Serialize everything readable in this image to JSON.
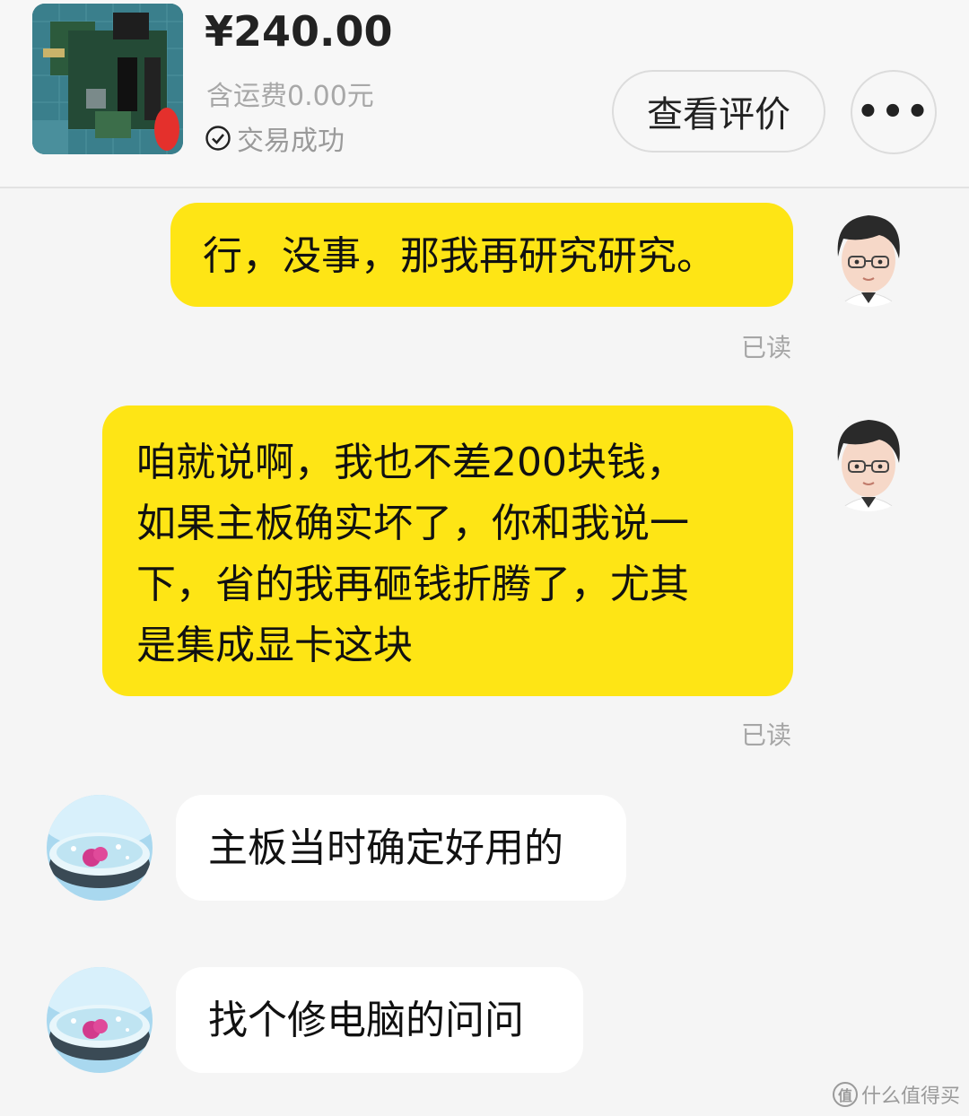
{
  "order": {
    "price": "¥240.00",
    "shipping": "含运费0.00元",
    "status": "交易成功",
    "review_button": "查看评价",
    "more_button": "•••"
  },
  "messages": [
    {
      "sender": "me",
      "text": "行，没事，那我再研究研究。",
      "read": "已读"
    },
    {
      "sender": "me",
      "lines": [
        "咱就说啊，我也不差200块钱，",
        "如果主板确实坏了，你和我说一",
        "下，省的我再砸钱折腾了，尤其",
        "是集成显卡这块"
      ],
      "read": "已读"
    },
    {
      "sender": "them",
      "text": "主板当时确定好用的"
    },
    {
      "sender": "them",
      "text": "找个修电脑的问问"
    }
  ],
  "watermark": {
    "icon_text": "值",
    "text": "什么值得买"
  },
  "colors": {
    "my_bubble": "#fee515",
    "their_bubble": "#ffffff",
    "background": "#f5f5f5"
  }
}
